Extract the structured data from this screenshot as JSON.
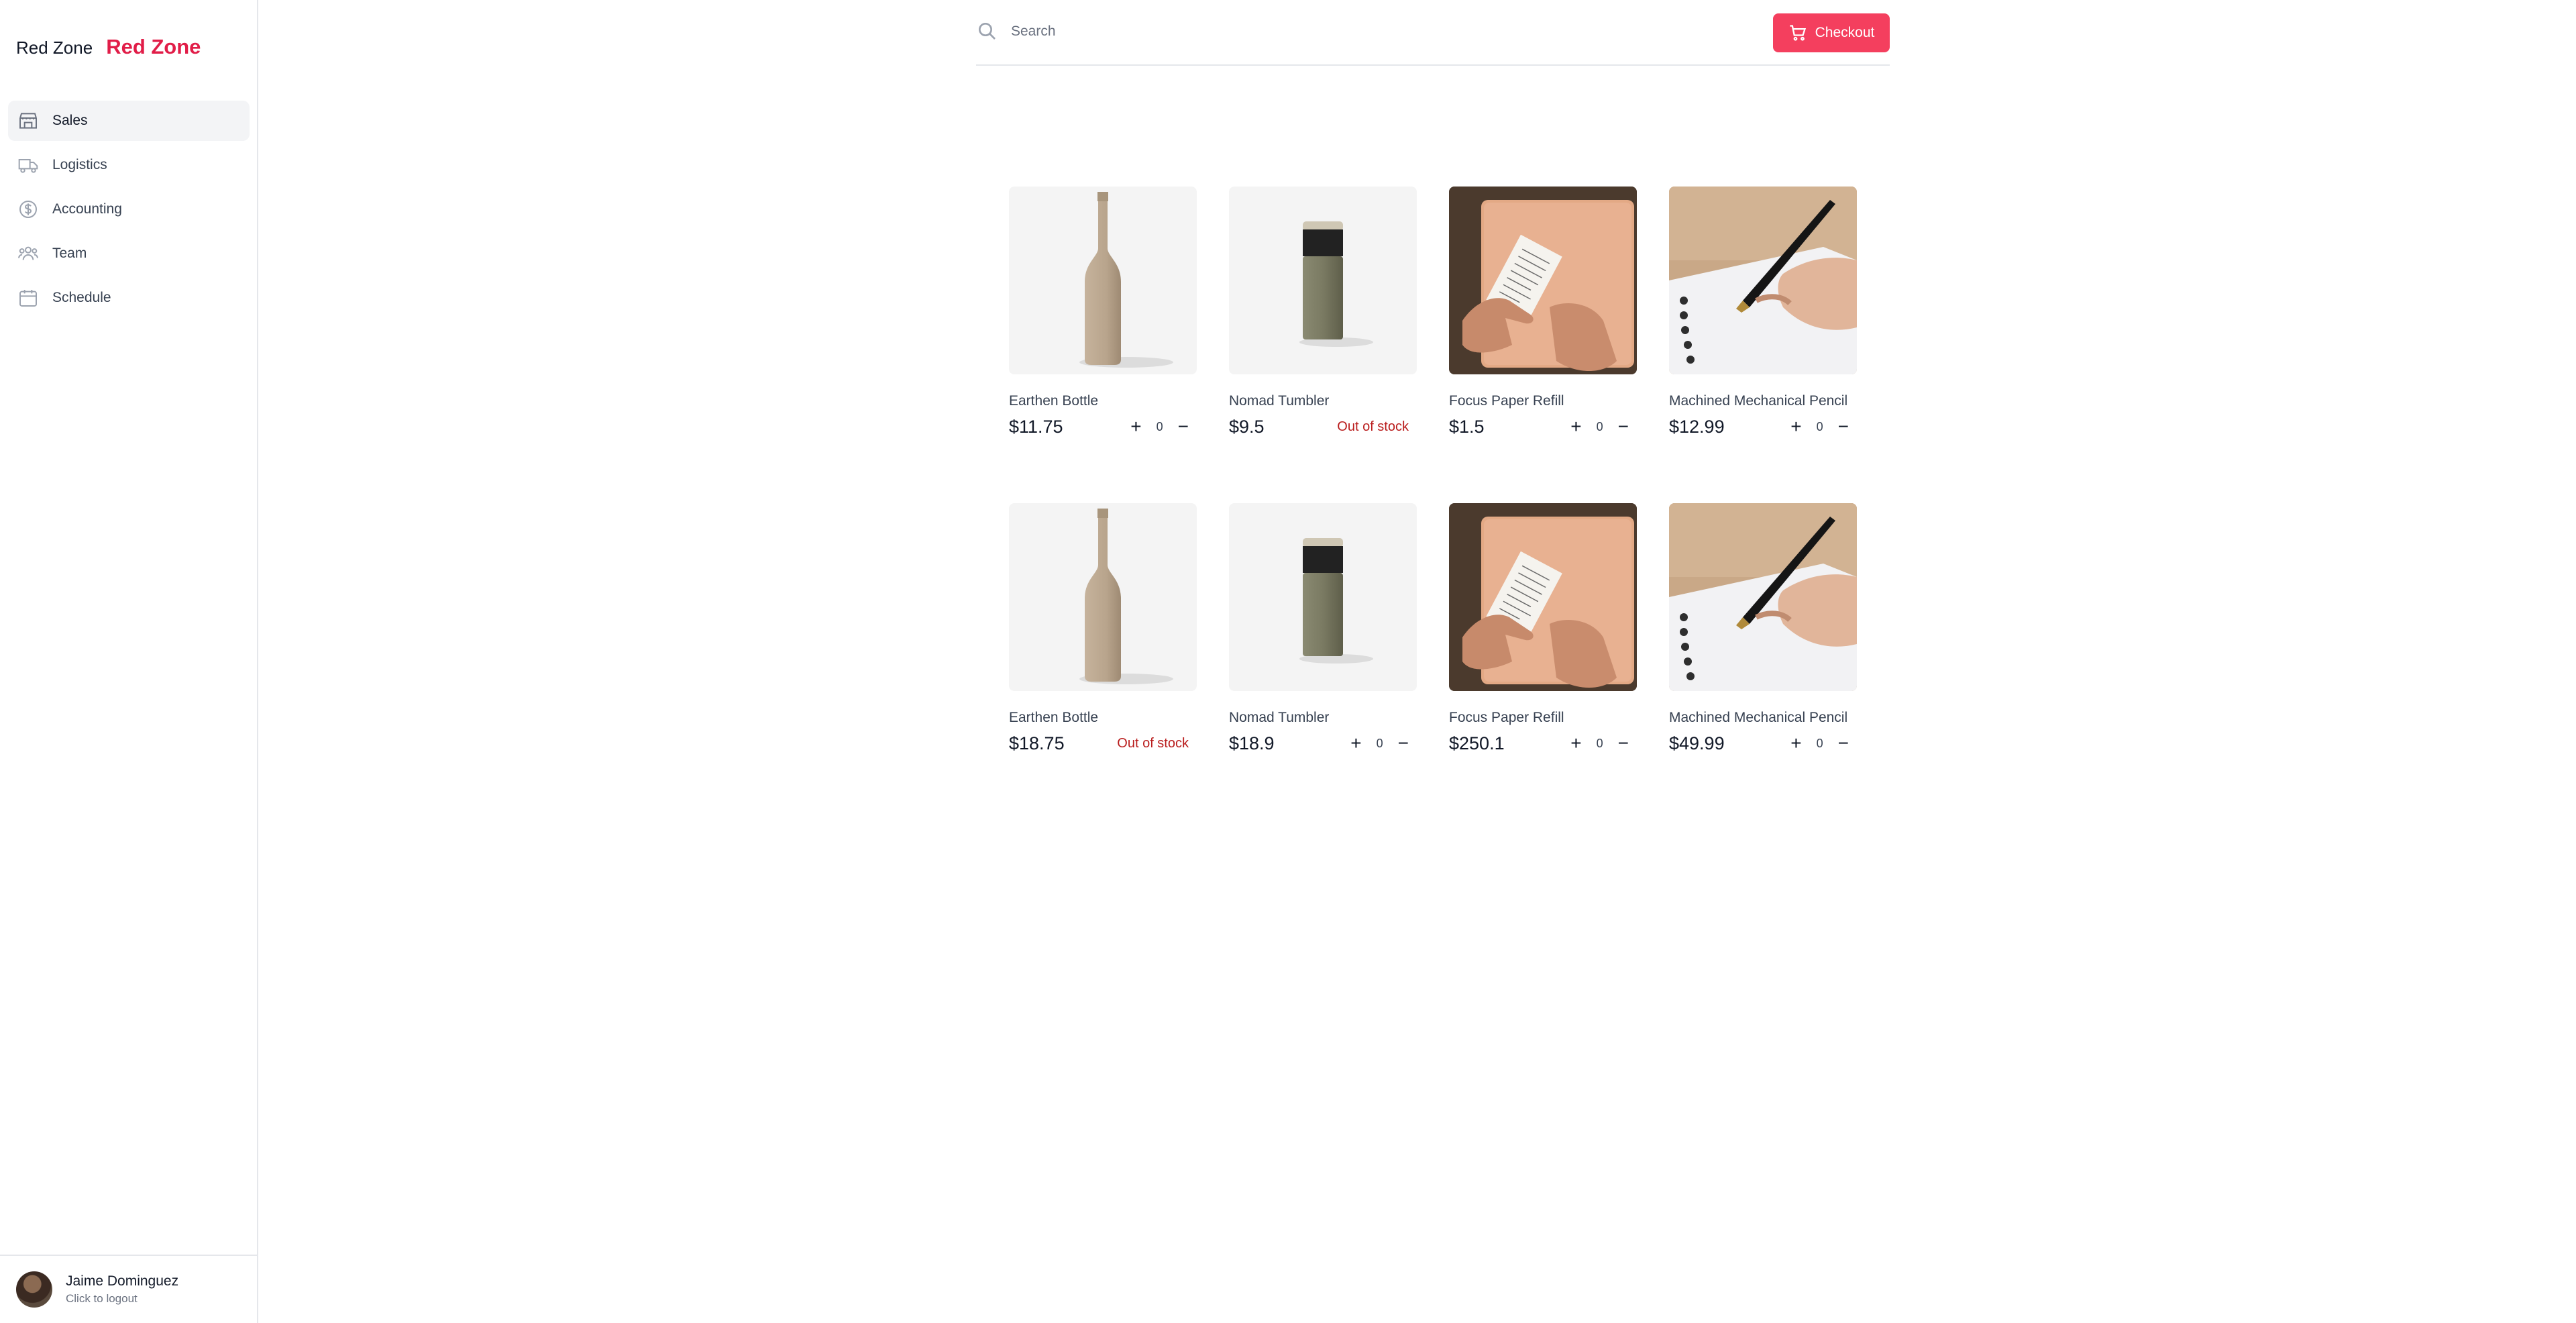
{
  "brand": {
    "small": "Red Zone",
    "big": "Red Zone",
    "accent": "#e11d48"
  },
  "sidebar": {
    "items": [
      {
        "label": "Sales",
        "icon": "storefront-icon",
        "active": true
      },
      {
        "label": "Logistics",
        "icon": "truck-icon"
      },
      {
        "label": "Accounting",
        "icon": "dollar-circle-icon"
      },
      {
        "label": "Team",
        "icon": "users-icon"
      },
      {
        "label": "Schedule",
        "icon": "calendar-icon"
      }
    ]
  },
  "user": {
    "name": "Jaime Dominguez",
    "subtitle": "Click to logout"
  },
  "search": {
    "placeholder": "Search"
  },
  "checkout": {
    "label": "Checkout",
    "color": "#f43f5e"
  },
  "products": [
    {
      "name": "Earthen Bottle",
      "price": "$11.75",
      "qty": "0",
      "image": "bottle"
    },
    {
      "name": "Nomad Tumbler",
      "price": "$9.5",
      "stock": "Out of stock",
      "image": "tumbler"
    },
    {
      "name": "Focus Paper Refill",
      "price": "$1.5",
      "qty": "0",
      "image": "paper"
    },
    {
      "name": "Machined Mechanical Pencil",
      "price": "$12.99",
      "qty": "0",
      "image": "pencil"
    },
    {
      "name": "Earthen Bottle",
      "price": "$18.75",
      "stock": "Out of stock",
      "image": "bottle"
    },
    {
      "name": "Nomad Tumbler",
      "price": "$18.9",
      "qty": "0",
      "image": "tumbler"
    },
    {
      "name": "Focus Paper Refill",
      "price": "$250.1",
      "qty": "0",
      "image": "paper"
    },
    {
      "name": "Machined Mechanical Pencil",
      "price": "$49.99",
      "qty": "0",
      "image": "pencil"
    }
  ]
}
